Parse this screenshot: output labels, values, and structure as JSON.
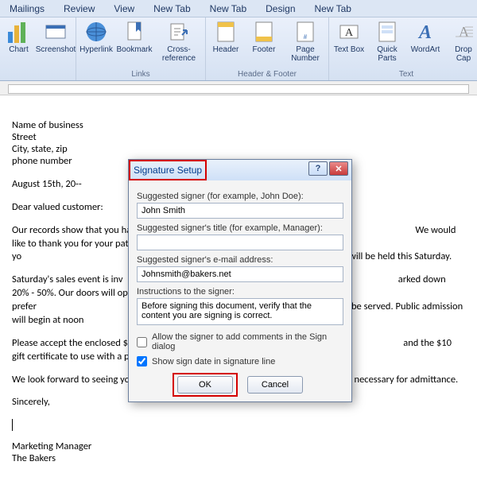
{
  "tabs": {
    "t0": "Mailings",
    "t1": "Review",
    "t2": "View",
    "t3": "New Tab",
    "t4": "New Tab",
    "t5": "Design",
    "t6": "New Tab"
  },
  "ribbon": {
    "chart": "Chart",
    "screenshot": "Screenshot",
    "hyperlink": "Hyperlink",
    "bookmark": "Bookmark",
    "crossref": "Cross-reference",
    "header": "Header",
    "footer": "Footer",
    "pagenum": "Page Number",
    "textbox": "Text Box",
    "quickparts": "Quick Parts",
    "wordart": "WordArt",
    "dropcap": "Drop Cap",
    "grp_links": "Links",
    "grp_hf": "Header & Footer",
    "grp_text": "Text"
  },
  "doc": {
    "l1": "Name of business",
    "l2": "Street",
    "l3": "City, state, zip",
    "l4": "phone number",
    "date": "August 15th, 20--",
    "greet": "Dear valued customer:",
    "p1a": "Our records show that you ha",
    "p1b": "We would like to thank you for your patronage by inviting yo",
    "p1c": "which will be held this Saturday.",
    "p2a": "Saturday's sales event is inv",
    "p2b": "arked down 20% - 50%. Our doors will open for our prefer",
    "p2c": "uts will be served. Public admission will begin at noon",
    "p3a": "Please accept the enclosed $",
    "p3b": "and the $10 gift certificate to use with a purchase of more",
    "p4": "We look forward to seeing you on Saturday. Please bring this invitation with you; it is necessary for admittance.",
    "signoff": "Sincerely,",
    "sig1": "Marketing Manager",
    "sig2": "The Bakers"
  },
  "dialog": {
    "title": "Signature Setup",
    "lbl_signer": "Suggested signer (for example, John Doe):",
    "val_signer": "John Smith",
    "lbl_title": "Suggested signer's title (for example, Manager):",
    "val_title": "",
    "lbl_email": "Suggested signer's e-mail address:",
    "val_email": "Johnsmith@bakers.net",
    "lbl_instr": "Instructions to the signer:",
    "val_instr": "Before signing this document, verify that the content you are signing is correct.",
    "chk1": "Allow the signer to add comments in the Sign dialog",
    "chk2": "Show sign date in signature line",
    "ok": "OK",
    "cancel": "Cancel"
  }
}
